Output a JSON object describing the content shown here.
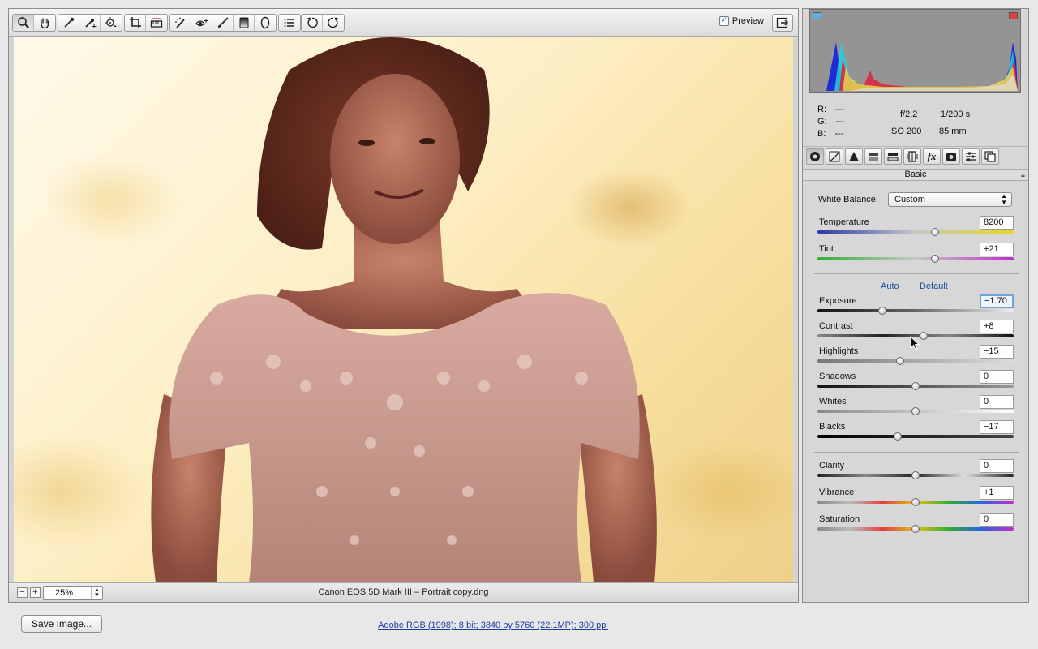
{
  "toolbar": {
    "tools": [
      "zoom-tool",
      "hand-tool",
      "white-balance-tool",
      "color-sampler-tool",
      "targeted-adjustment-tool",
      "crop-tool",
      "straighten-tool",
      "spot-removal-tool",
      "red-eye-tool",
      "adjustment-brush-tool",
      "graduated-filter-tool",
      "radial-filter-tool",
      "preferences",
      "rotate-left",
      "rotate-right"
    ],
    "preview_label": "Preview",
    "preview_checked": true
  },
  "statusbar": {
    "zoom_out": "−",
    "zoom_in": "+",
    "zoom_value": "25%",
    "filename": "Canon EOS 5D Mark III  –  Portrait copy.dng"
  },
  "info": {
    "r_label": "R:",
    "r_value": "---",
    "g_label": "G:",
    "g_value": "---",
    "b_label": "B:",
    "b_value": "---",
    "aperture": "f/2.2",
    "shutter": "1/200 s",
    "iso": "ISO 200",
    "focal": "85 mm"
  },
  "panel": {
    "title": "Basic",
    "menu_icon": "≡",
    "white_balance_label": "White Balance:",
    "white_balance_value": "Custom",
    "auto_link": "Auto",
    "default_link": "Default",
    "sliders": {
      "temperature": {
        "label": "Temperature",
        "value": "8200",
        "position": 0.6
      },
      "tint": {
        "label": "Tint",
        "value": "+21",
        "position": 0.6
      },
      "exposure": {
        "label": "Exposure",
        "value": "−1.70",
        "position": 0.33
      },
      "contrast": {
        "label": "Contrast",
        "value": "+8",
        "position": 0.54
      },
      "highlights": {
        "label": "Highlights",
        "value": "−15",
        "position": 0.42
      },
      "shadows": {
        "label": "Shadows",
        "value": "0",
        "position": 0.5
      },
      "whites": {
        "label": "Whites",
        "value": "0",
        "position": 0.5
      },
      "blacks": {
        "label": "Blacks",
        "value": "−17",
        "position": 0.41
      },
      "clarity": {
        "label": "Clarity",
        "value": "0",
        "position": 0.5
      },
      "vibrance": {
        "label": "Vibrance",
        "value": "+1",
        "position": 0.5
      },
      "saturation": {
        "label": "Saturation",
        "value": "0",
        "position": 0.5
      }
    }
  },
  "bottom": {
    "save_button": "Save Image...",
    "workflow_link": "Adobe RGB (1998); 8 bit; 3840 by 5760 (22.1MP); 300 ppi"
  }
}
